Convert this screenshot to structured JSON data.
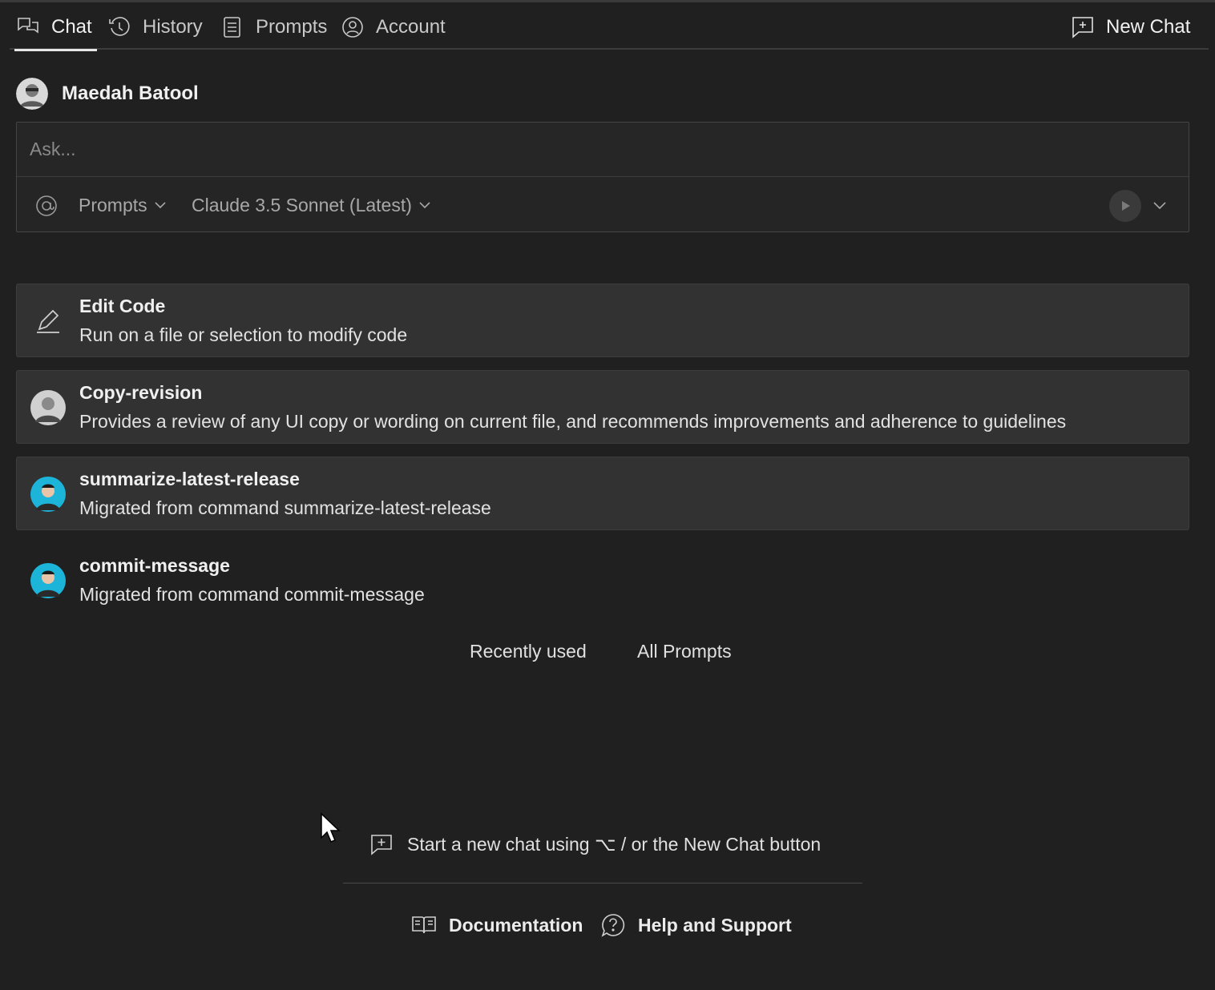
{
  "tabs": {
    "chat": "Chat",
    "history": "History",
    "prompts": "Prompts",
    "account": "Account",
    "new_chat": "New Chat"
  },
  "user": {
    "name": "Maedah Batool"
  },
  "ask": {
    "placeholder": "Ask...",
    "prompts_label": "Prompts",
    "model_label": "Claude 3.5 Sonnet (Latest)"
  },
  "prompts": [
    {
      "title": "Edit Code",
      "description": "Run on a file or selection to modify code",
      "icon": "pencil-icon"
    },
    {
      "title": "Copy-revision",
      "description": "Provides a review of any UI copy or wording on current file, and recommends improvements and adherence to guidelines",
      "icon": "avatar"
    },
    {
      "title": "summarize-latest-release",
      "description": "Migrated from command summarize-latest-release",
      "icon": "avatar"
    },
    {
      "title": "commit-message",
      "description": "Migrated from command commit-message",
      "icon": "avatar"
    }
  ],
  "prompt_tabs": {
    "recent": "Recently used",
    "all": "All Prompts"
  },
  "hint": "Start a new chat using ⌥ / or the New Chat button",
  "footer": {
    "documentation": "Documentation",
    "help": "Help and Support"
  },
  "colors": {
    "background": "#202020",
    "card": "#323232",
    "text": "#f0f0f0"
  }
}
